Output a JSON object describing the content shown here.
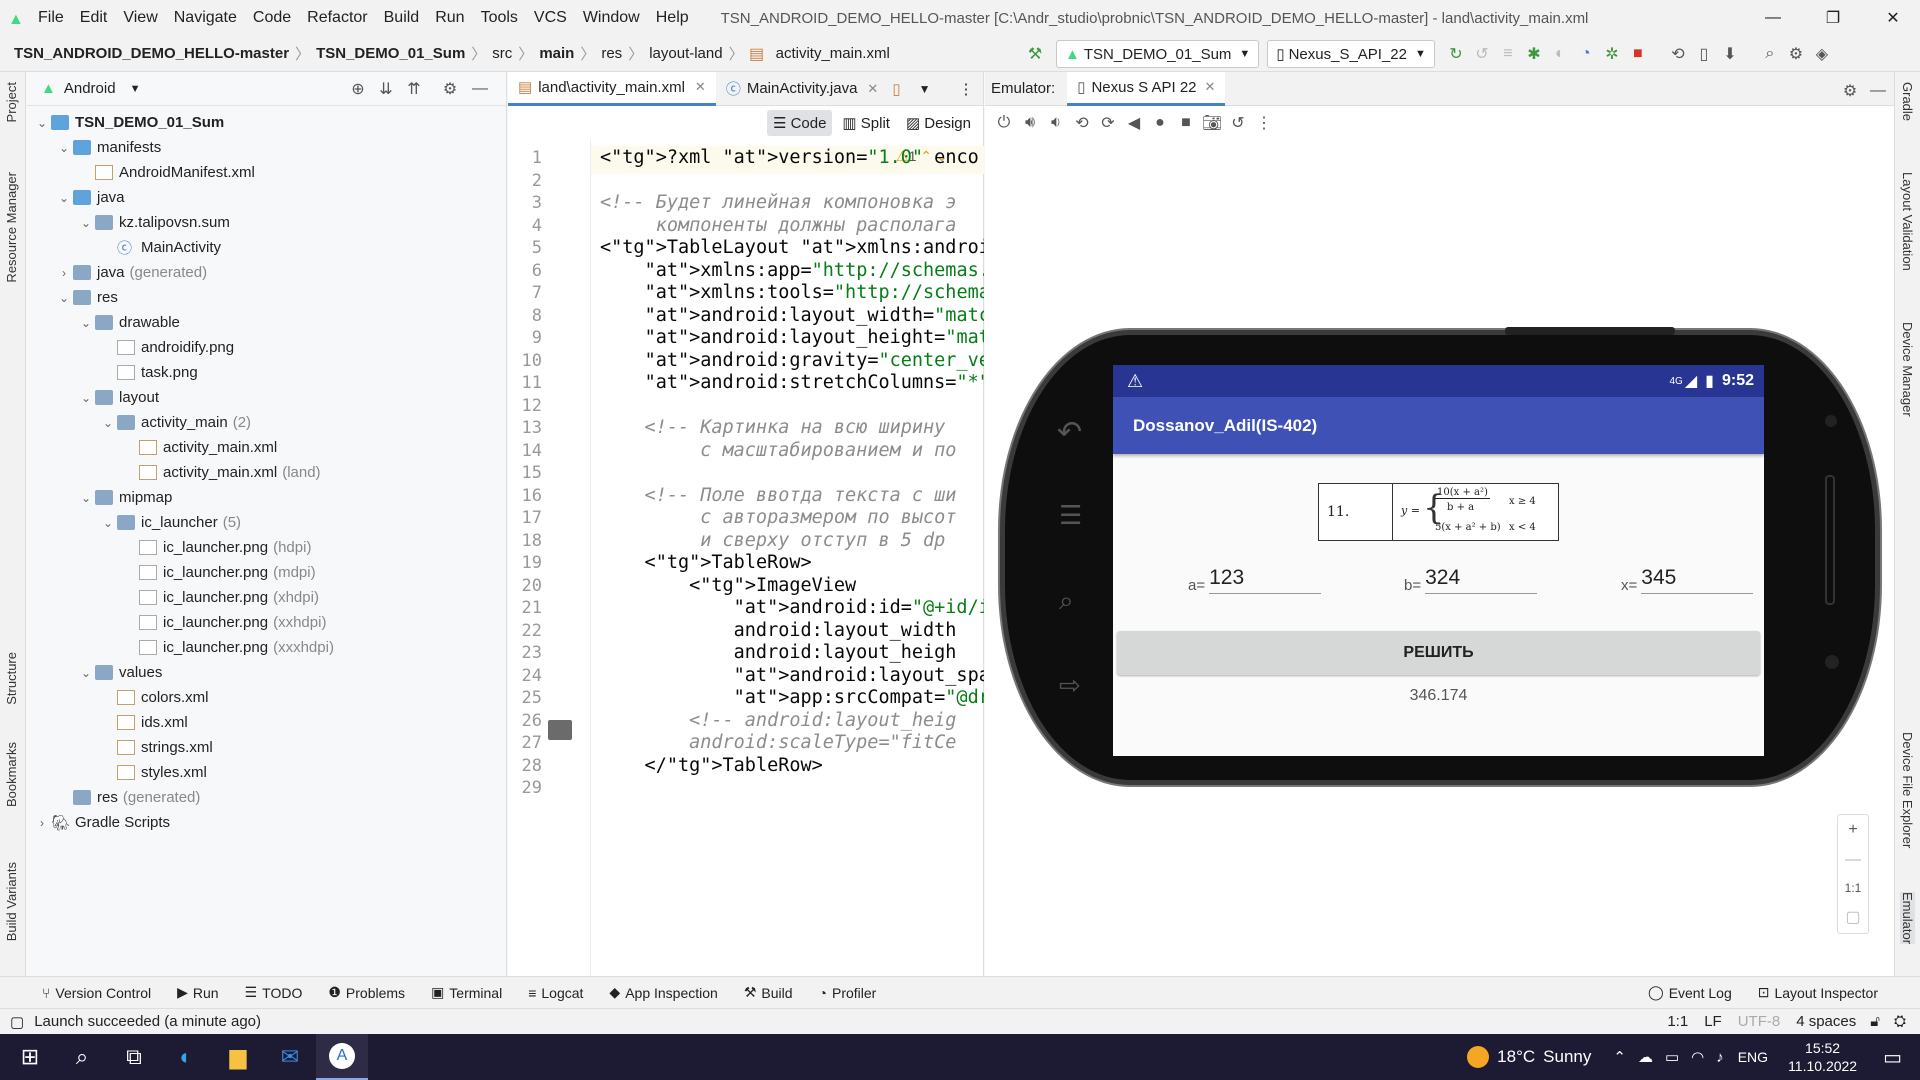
{
  "titlebar": {
    "menu": [
      "File",
      "Edit",
      "View",
      "Navigate",
      "Code",
      "Refactor",
      "Build",
      "Run",
      "Tools",
      "VCS",
      "Window",
      "Help"
    ],
    "window_title": "TSN_ANDROID_DEMO_HELLO-master [C:\\Andr_studio\\probnic\\TSN_ANDROID_DEMO_HELLO-master] - land\\activity_main.xml"
  },
  "navbar": {
    "crumbs": [
      "TSN_ANDROID_DEMO_HELLO-master",
      "TSN_DEMO_01_Sum",
      "src",
      "main",
      "res",
      "layout-land",
      "activity_main.xml"
    ],
    "run_config": "TSN_DEMO_01_Sum",
    "device": "Nexus_S_API_22"
  },
  "left_stripe": [
    "Project",
    "Resource Manager",
    "Structure",
    "Bookmarks",
    "Build Variants"
  ],
  "right_stripe": [
    "Gradle",
    "Layout Validation",
    "Device Manager",
    "Device File Explorer",
    "Emulator"
  ],
  "project": {
    "view": "Android",
    "tree": [
      {
        "label": "TSN_DEMO_01_Sum",
        "extra": ""
      },
      {
        "label": "manifests",
        "extra": ""
      },
      {
        "label": "AndroidManifest.xml",
        "extra": ""
      },
      {
        "label": "java",
        "extra": ""
      },
      {
        "label": "kz.talipovsn.sum",
        "extra": ""
      },
      {
        "label": "MainActivity",
        "extra": ""
      },
      {
        "label": "java",
        "extra": "(generated)"
      },
      {
        "label": "res",
        "extra": ""
      },
      {
        "label": "drawable",
        "extra": ""
      },
      {
        "label": "androidify.png",
        "extra": ""
      },
      {
        "label": "task.png",
        "extra": ""
      },
      {
        "label": "layout",
        "extra": ""
      },
      {
        "label": "activity_main",
        "extra": "(2)"
      },
      {
        "label": "activity_main.xml",
        "extra": ""
      },
      {
        "label": "activity_main.xml",
        "extra": "(land)"
      },
      {
        "label": "mipmap",
        "extra": ""
      },
      {
        "label": "ic_launcher",
        "extra": "(5)"
      },
      {
        "label": "ic_launcher.png",
        "extra": "(hdpi)"
      },
      {
        "label": "ic_launcher.png",
        "extra": "(mdpi)"
      },
      {
        "label": "ic_launcher.png",
        "extra": "(xhdpi)"
      },
      {
        "label": "ic_launcher.png",
        "extra": "(xxhdpi)"
      },
      {
        "label": "ic_launcher.png",
        "extra": "(xxxhdpi)"
      },
      {
        "label": "values",
        "extra": ""
      },
      {
        "label": "colors.xml",
        "extra": ""
      },
      {
        "label": "ids.xml",
        "extra": ""
      },
      {
        "label": "strings.xml",
        "extra": ""
      },
      {
        "label": "styles.xml",
        "extra": ""
      },
      {
        "label": "res",
        "extra": "(generated)"
      },
      {
        "label": "Gradle Scripts",
        "extra": ""
      }
    ]
  },
  "editor": {
    "tabs": [
      "land\\activity_main.xml",
      "MainActivity.java"
    ],
    "modes": [
      "Code",
      "Split",
      "Design"
    ],
    "warning_count": "1",
    "line_numbers": [
      "1",
      "2",
      "3",
      "4",
      "5",
      "6",
      "7",
      "8",
      "9",
      "10",
      "11",
      "12",
      "13",
      "14",
      "15",
      "16",
      "17",
      "18",
      "19",
      "20",
      "21",
      "22",
      "23",
      "24",
      "25",
      "26",
      "27",
      "28",
      "29"
    ],
    "lines": [
      "<?xml version=\"1.0\" enco",
      "",
      "<!-- Будет линейная компоновка э",
      "     компоненты должны располага",
      "<TableLayout xmlns:android=\"http",
      "    xmlns:app=\"http://schemas.an",
      "    xmlns:tools=\"http://schemas.",
      "    android:layout_width=\"match_",
      "    android:layout_height=\"match",
      "    android:gravity=\"center_vert",
      "    android:stretchColumns=\"*\">",
      "",
      "    <!-- Картинка на всю ширину",
      "         с масштабированием и по",
      "",
      "    <!-- Поле ввотда текста с ши",
      "         с авторазмером по высот",
      "         и сверху отступ в 5 dp",
      "    <TableRow>",
      "        <ImageView",
      "            android:id=\"@+id/ima",
      "            android:layout_width",
      "            android:layout_heigh",
      "            android:layout_span=",
      "            app:srcCompat=\"@draw",
      "        <!-- android:layout_heig",
      "        android:scaleType=\"fitCe",
      "    </TableRow>",
      ""
    ]
  },
  "emulator": {
    "label": "Emulator:",
    "tab": "Nexus S API 22",
    "zoom_label": "1:1"
  },
  "app": {
    "status_time": "9:52",
    "network": "4G",
    "title": "Dossanov_Adil(IS-402)",
    "task_number": "11.",
    "formula": {
      "y": "y =",
      "top_num": "10(x + a²)",
      "top_den": "b + a",
      "top_cond": "x ≥ 4",
      "bottom": "5(x + a² + b)",
      "bottom_cond": "x < 4"
    },
    "fields": [
      {
        "label": "a=",
        "value": "123"
      },
      {
        "label": "b=",
        "value": "324"
      },
      {
        "label": "x=",
        "value": "345"
      }
    ],
    "button": "РЕШИТЬ",
    "result": "346.174"
  },
  "bottom_tabs": [
    "Version Control",
    "Run",
    "TODO",
    "Problems",
    "Terminal",
    "Logcat",
    "App Inspection",
    "Build",
    "Profiler"
  ],
  "bottom_right": "Event Log",
  "bottom_right2": "Layout Inspector",
  "status": {
    "message": "Launch succeeded (a minute ago)",
    "pos": "1:1",
    "lf": "LF",
    "enc": "UTF-8",
    "indent": "4 spaces"
  },
  "taskbar": {
    "temp": "18°C",
    "weather": "Sunny",
    "lang": "ENG",
    "time": "15:52",
    "date": "11.10.2022"
  },
  "colors": {
    "app_primary": "#3f51b5",
    "status_bar": "#283593",
    "android_green": "#3ddc84"
  }
}
